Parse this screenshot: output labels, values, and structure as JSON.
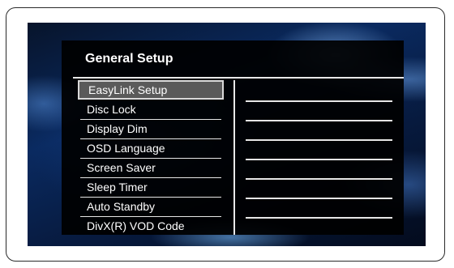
{
  "menu": {
    "title": "General Setup",
    "selected_index": 0,
    "items": [
      {
        "label": "EasyLink Setup"
      },
      {
        "label": "Disc Lock"
      },
      {
        "label": "Display Dim"
      },
      {
        "label": "OSD Language"
      },
      {
        "label": "Screen Saver"
      },
      {
        "label": "Sleep Timer"
      },
      {
        "label": "Auto Standby"
      },
      {
        "label": "DivX(R) VOD Code"
      }
    ],
    "value_rows": 7
  },
  "colors": {
    "panel": "#000000",
    "text": "#ffffff",
    "highlight": "#5a5a5a"
  }
}
